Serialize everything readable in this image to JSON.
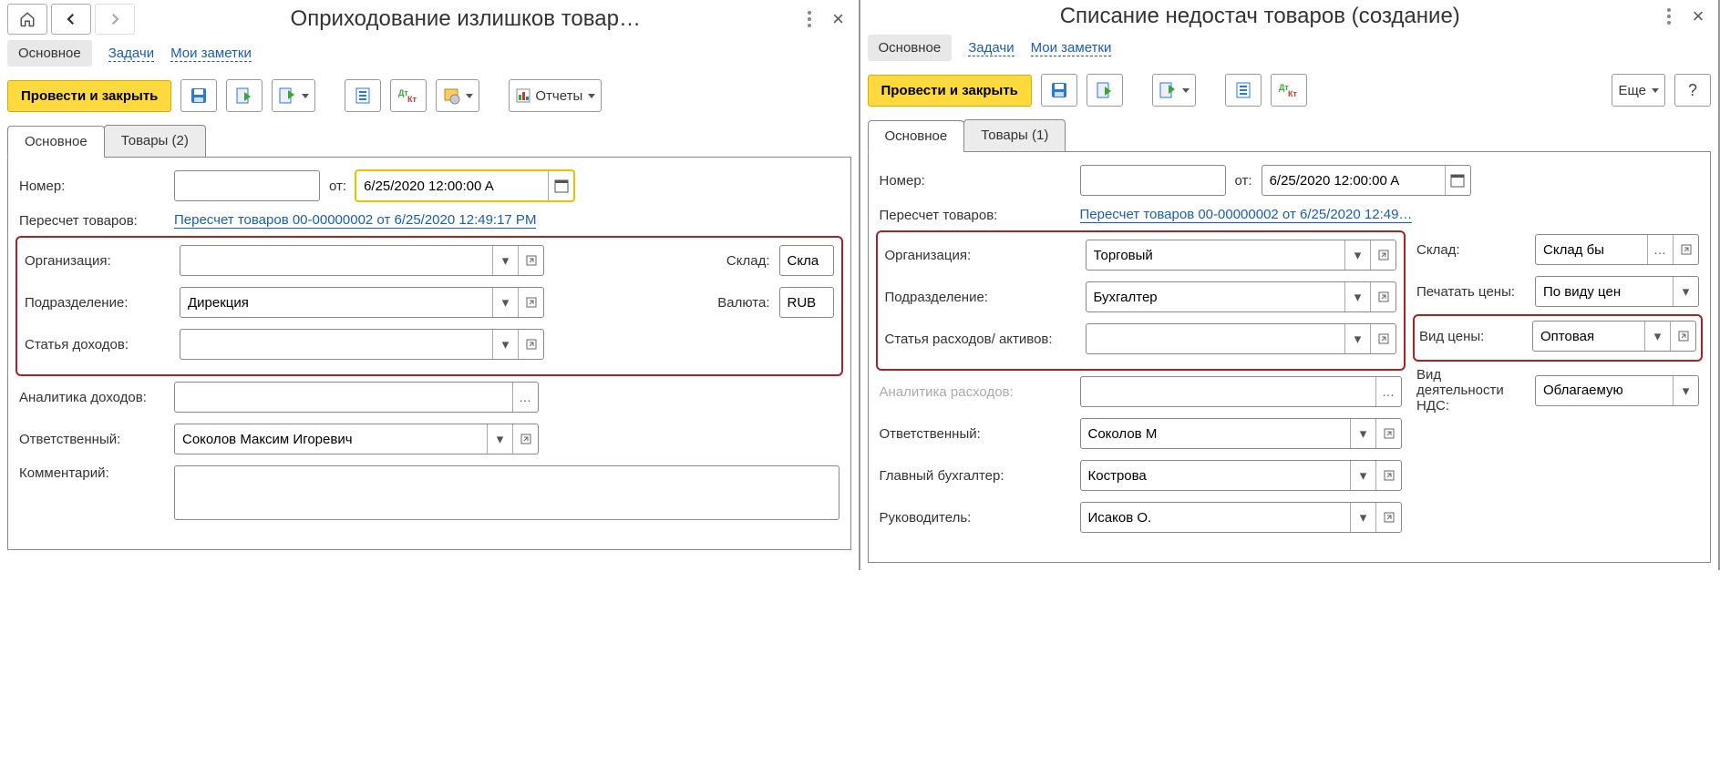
{
  "left": {
    "title": "Оприходование излишков товар…",
    "linkbar": {
      "main": "Основное",
      "tasks": "Задачи",
      "notes": "Мои заметки"
    },
    "toolbar": {
      "post_close": "Провести и закрыть",
      "reports": "Отчеты"
    },
    "tabs": {
      "main": "Основное",
      "goods": "Товары (2)"
    },
    "labels": {
      "number": "Номер:",
      "from": "от:",
      "recount": "Пересчет товаров:",
      "org": "Организация:",
      "dept": "Подразделение:",
      "income": "Статья доходов:",
      "analytics": "Аналитика доходов:",
      "resp": "Ответственный:",
      "comment": "Комментарий:",
      "warehouse": "Склад:",
      "currency": "Валюта:"
    },
    "values": {
      "number": "",
      "date": "6/25/2020 12:00:00 A",
      "recount_link": "Пересчет товаров 00-00000002 от 6/25/2020 12:49:17 PM",
      "org": "",
      "dept": "Дирекция",
      "income": "",
      "analytics": "",
      "resp": "Соколов Максим Игоревич",
      "comment": "",
      "warehouse": "Скла",
      "currency": "RUB"
    }
  },
  "right": {
    "title": "Списание недостач товаров (создание)",
    "linkbar": {
      "main": "Основное",
      "tasks": "Задачи",
      "notes": "Мои заметки"
    },
    "toolbar": {
      "post_close": "Провести и закрыть",
      "more": "Еще"
    },
    "tabs": {
      "main": "Основное",
      "goods": "Товары (1)"
    },
    "labels": {
      "number": "Номер:",
      "from": "от:",
      "recount": "Пересчет товаров:",
      "org": "Организация:",
      "dept": "Подразделение:",
      "expense": "Статья расходов/ активов:",
      "analytics": "Аналитика расходов:",
      "resp": "Ответственный:",
      "chief_acc": "Главный бухгалтер:",
      "director": "Руководитель:",
      "warehouse": "Склад:",
      "print_price": "Печатать цены:",
      "price_kind": "Вид цены:",
      "vat_kind": "Вид деятельности НДС:"
    },
    "values": {
      "number": "",
      "date": "6/25/2020 12:00:00 A",
      "recount_link": "Пересчет товаров 00-00000002 от 6/25/2020 12:49…",
      "org": "Торговый",
      "dept": "Бухгалтер",
      "expense": "",
      "analytics": "",
      "resp": "Соколов М",
      "chief_acc": "Кострова",
      "director": "Исаков О.",
      "warehouse": "Склад бы",
      "print_price": "По виду цен",
      "price_kind": "Оптовая",
      "vat_kind": "Облагаемую"
    }
  }
}
